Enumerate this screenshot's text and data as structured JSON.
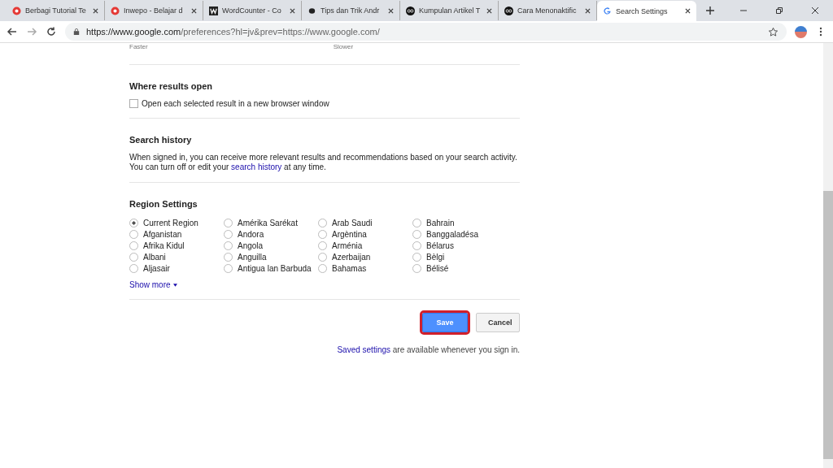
{
  "tabs": [
    {
      "title": "Berbagi Tutorial Te",
      "kind": "red-circle",
      "selected": false
    },
    {
      "title": "Inwepo - Belajar d",
      "kind": "red-circle",
      "selected": false
    },
    {
      "title": "WordCounter - Co",
      "kind": "letter-w",
      "selected": false
    },
    {
      "title": "Tips dan Trik Andr",
      "kind": "dot",
      "selected": false
    },
    {
      "title": "Kumpulan Artikel T",
      "kind": "glasses",
      "selected": false
    },
    {
      "title": "Cara Menonaktific",
      "kind": "glasses",
      "selected": false
    },
    {
      "title": "Search Settings",
      "kind": "g",
      "selected": true
    }
  ],
  "address": {
    "host": "https://www.google.com",
    "path": "/preferences?hl=jv&prev=https://www.google.com/"
  },
  "speed_labels": [
    "Faster",
    "Slower"
  ],
  "results_open": {
    "heading": "Where results open",
    "option": "Open each selected result in a new browser window",
    "checked": false
  },
  "search_history": {
    "heading": "Search history",
    "before": "When signed in, you can receive more relevant results and recommendations based on your search activity. You can turn off or edit your",
    "link": "search history",
    "after": "at any time."
  },
  "region": {
    "heading": "Region Settings",
    "options": [
      {
        "label": "Current Region",
        "selected": true
      },
      {
        "label": "Afganistan",
        "selected": false
      },
      {
        "label": "Afrika Kidul",
        "selected": false
      },
      {
        "label": "Albani",
        "selected": false
      },
      {
        "label": "Aljasair",
        "selected": false
      },
      {
        "label": "Amérika Sarékat",
        "selected": false
      },
      {
        "label": "Andora",
        "selected": false
      },
      {
        "label": "Angola",
        "selected": false
      },
      {
        "label": "Anguilla",
        "selected": false
      },
      {
        "label": "Antigua lan Barbuda",
        "selected": false
      },
      {
        "label": "Arab Saudi",
        "selected": false
      },
      {
        "label": "Argèntina",
        "selected": false
      },
      {
        "label": "Arménia",
        "selected": false
      },
      {
        "label": "Azerbaijan",
        "selected": false
      },
      {
        "label": "Bahamas",
        "selected": false
      },
      {
        "label": "Bahrain",
        "selected": false
      },
      {
        "label": "Banggaladésa",
        "selected": false
      },
      {
        "label": "Bélarus",
        "selected": false
      },
      {
        "label": "Bèlgi",
        "selected": false
      },
      {
        "label": "Bélisé",
        "selected": false
      }
    ],
    "show_more": "Show more"
  },
  "buttons": [
    {
      "label": "Save",
      "kind": "primary",
      "highlighted": true
    },
    {
      "label": "Cancel",
      "kind": "secondary",
      "highlighted": false
    }
  ],
  "saved_note": {
    "link": "Saved settings",
    "after": "are available whenever you sign in."
  }
}
